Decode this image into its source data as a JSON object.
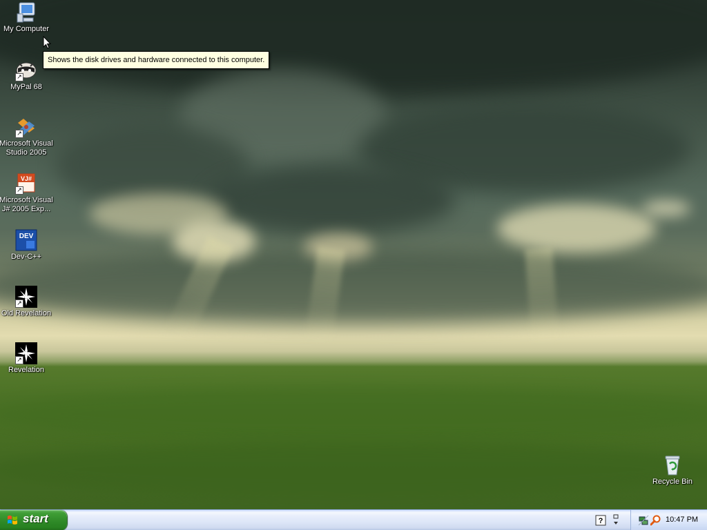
{
  "desktop": {
    "icons": [
      {
        "label": "My Computer",
        "icon": "computer-icon"
      },
      {
        "label": "MyPal 68",
        "icon": "raccoon-browser-icon"
      },
      {
        "label": "Microsoft Visual Studio 2005",
        "icon": "visual-studio-icon"
      },
      {
        "label": "Microsoft Visual J# 2005 Exp...",
        "icon": "visual-jsharp-icon",
        "badge": "VJ#"
      },
      {
        "label": "Dev-C++",
        "icon": "dev-cpp-icon",
        "badge": "DEV"
      },
      {
        "label": "Old Revelation",
        "icon": "revelation-icon"
      },
      {
        "label": "Revelation",
        "icon": "revelation-icon"
      },
      {
        "label": "Recycle Bin",
        "icon": "recycle-bin-icon"
      }
    ]
  },
  "tooltip": {
    "text": "Shows the disk drives and hardware connected to this computer."
  },
  "taskbar": {
    "start_label": "start",
    "clock": "10:47 PM",
    "quick_launch_icon": "help-icon",
    "tray_icons": [
      "network-icon",
      "search-icon"
    ]
  },
  "colors": {
    "start_green": "#3f9e36",
    "taskbar_blue": "#dde6f8",
    "tooltip_bg": "#ffffe1"
  }
}
